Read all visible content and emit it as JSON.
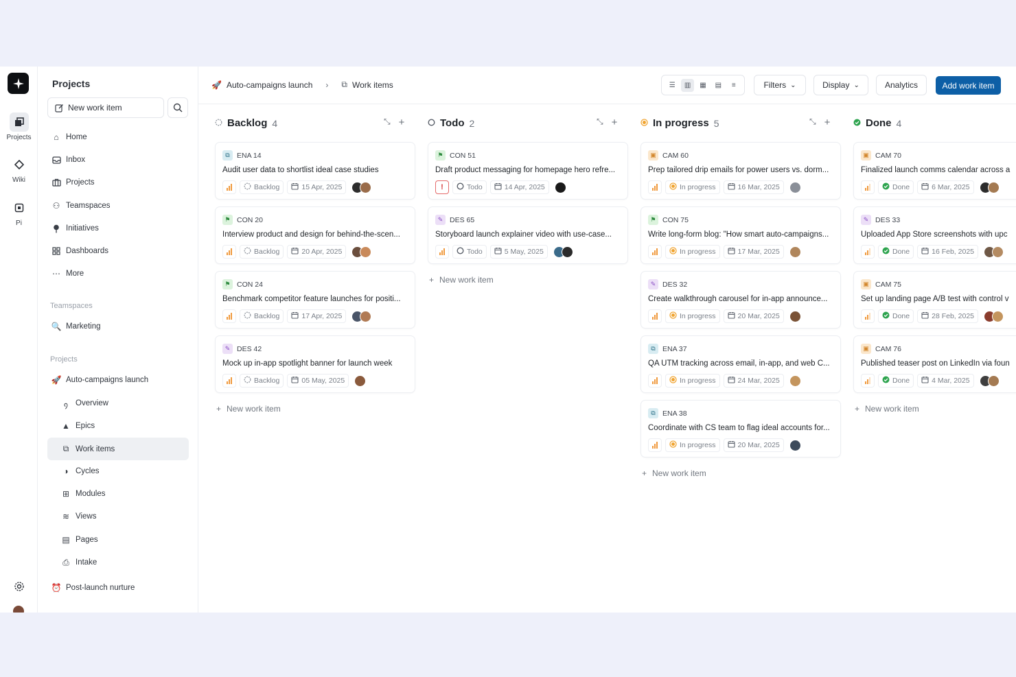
{
  "rail": {
    "items": [
      {
        "label": "Projects",
        "icon": "projects-icon"
      },
      {
        "label": "Wiki",
        "icon": "wiki-icon"
      },
      {
        "label": "Pi",
        "icon": "pi-icon"
      }
    ]
  },
  "sidebar": {
    "title": "Projects",
    "new_item": "New work item",
    "nav": [
      "Home",
      "Inbox",
      "Projects",
      "Teamspaces",
      "Initiatives",
      "Dashboards",
      "More"
    ],
    "teamspaces_label": "Teamspaces",
    "teamspaces": [
      "Marketing"
    ],
    "projects_label": "Projects",
    "project_name": "Auto-campaigns launch",
    "project_sub": [
      "Overview",
      "Epics",
      "Work items",
      "Cycles",
      "Modules",
      "Views",
      "Pages",
      "Intake"
    ],
    "other_project": "Post-launch nurture"
  },
  "header": {
    "breadcrumb_project": "Auto-campaigns launch",
    "breadcrumb_page": "Work items",
    "filters": "Filters",
    "display": "Display",
    "analytics": "Analytics",
    "add": "Add work item"
  },
  "colors": {
    "accent": "#0d5fa6",
    "in_progress": "#f0a430",
    "done": "#2ea44f",
    "urgent": "#d63b3b",
    "priority": "#f09a3e"
  },
  "columns": [
    {
      "name": "Backlog",
      "count": "4",
      "cards": [
        {
          "id": "ENA 14",
          "title": "Audit user data to shortlist ideal case studies",
          "status": "Backlog",
          "date": "15 Apr, 2025"
        },
        {
          "id": "CON 20",
          "title": "Interview product and design for behind-the-scen...",
          "status": "Backlog",
          "date": "20 Apr, 2025"
        },
        {
          "id": "CON 24",
          "title": "Benchmark competitor feature launches for positi...",
          "status": "Backlog",
          "date": "17 Apr, 2025"
        },
        {
          "id": "DES 42",
          "title": "Mock up in-app spotlight banner for launch week",
          "status": "Backlog",
          "date": "05 May, 2025"
        }
      ],
      "new_label": "New work item"
    },
    {
      "name": "Todo",
      "count": "2",
      "cards": [
        {
          "id": "CON 51",
          "title": "Draft product messaging for homepage hero refre...",
          "status": "Todo",
          "date": "14 Apr, 2025"
        },
        {
          "id": "DES 65",
          "title": "Storyboard launch explainer video with use-case...",
          "status": "Todo",
          "date": "5 May, 2025"
        }
      ],
      "new_label": "New work item"
    },
    {
      "name": "In progress",
      "count": "5",
      "cards": [
        {
          "id": "CAM 60",
          "title": "Prep tailored drip emails for power users vs. dorm...",
          "status": "In progress",
          "date": "16 Mar, 2025"
        },
        {
          "id": "CON 75",
          "title": "Write long-form blog: \"How smart auto-campaigns...",
          "status": "In progress",
          "date": "17 Mar, 2025"
        },
        {
          "id": "DES 32",
          "title": "Create walkthrough carousel for in-app announce...",
          "status": "In progress",
          "date": "20 Mar, 2025"
        },
        {
          "id": "ENA 37",
          "title": "QA UTM tracking across email, in-app, and web C...",
          "status": "In progress",
          "date": "24 Mar, 2025"
        },
        {
          "id": "ENA 38",
          "title": "Coordinate with CS team to flag ideal accounts for...",
          "status": "In progress",
          "date": "20 Mar, 2025"
        }
      ],
      "new_label": "New work item"
    },
    {
      "name": "Done",
      "count": "4",
      "cards": [
        {
          "id": "CAM 70",
          "title": "Finalized launch comms calendar across a",
          "status": "Done",
          "date": "6 Mar, 2025"
        },
        {
          "id": "DES 33",
          "title": "Uploaded App Store screenshots with upc",
          "status": "Done",
          "date": "16 Feb, 2025"
        },
        {
          "id": "CAM 75",
          "title": "Set up landing page A/B test with control v",
          "status": "Done",
          "date": "28 Feb, 2025"
        },
        {
          "id": "CAM 76",
          "title": "Published teaser post on LinkedIn via foun",
          "status": "Done",
          "date": "4 Mar, 2025"
        }
      ],
      "new_label": "New work item"
    }
  ]
}
